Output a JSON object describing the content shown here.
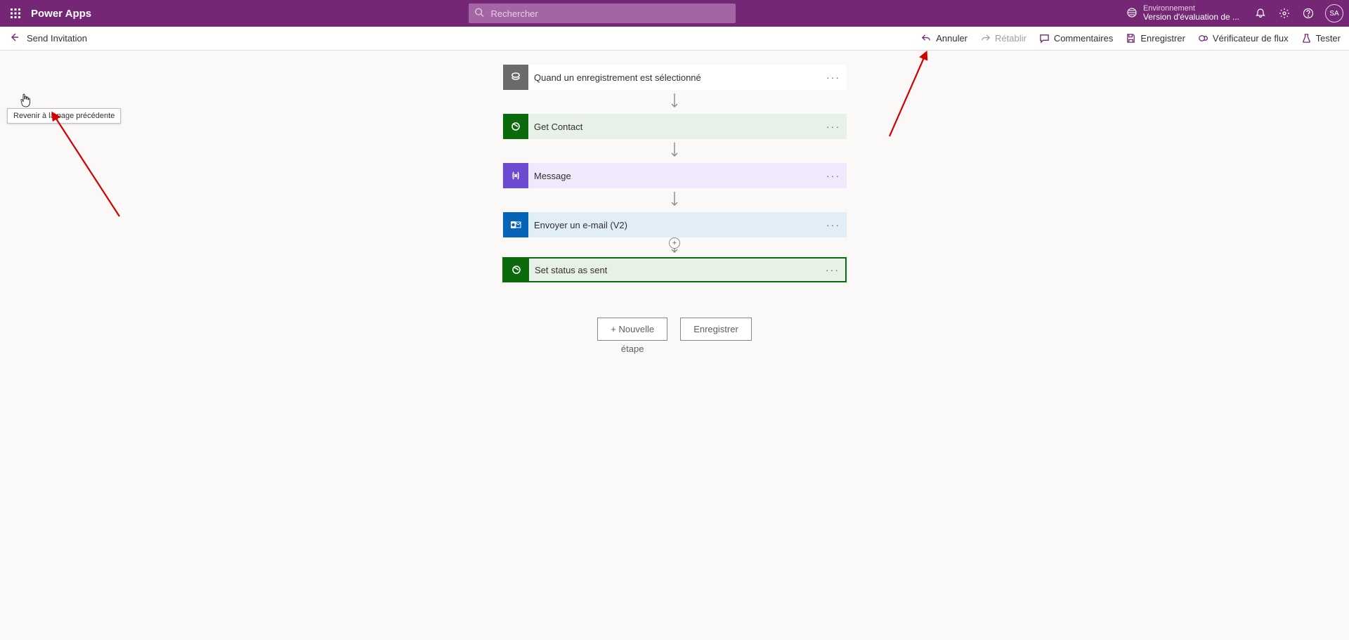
{
  "topbar": {
    "brand": "Power Apps",
    "search_placeholder": "Rechercher",
    "env_label": "Environnement",
    "env_name": "Version d'évaluation de ...",
    "avatar": "SA"
  },
  "toolbar": {
    "flow_name": "Send Invitation",
    "tooltip": "Revenir à la page précédente",
    "actions": {
      "undo": "Annuler",
      "redo": "Rétablir",
      "comments": "Commentaires",
      "save": "Enregistrer",
      "checker": "Vérificateur de flux",
      "test": "Tester"
    }
  },
  "flow": {
    "steps": [
      {
        "title": "Quand un enregistrement est sélectionné",
        "icon": "record",
        "style": "gray",
        "card": "trigger"
      },
      {
        "title": "Get Contact",
        "icon": "dataverse",
        "style": "green",
        "card": "dv"
      },
      {
        "title": "Message",
        "icon": "variable",
        "style": "purple",
        "card": "msg"
      },
      {
        "title": "Envoyer un e-mail (V2)",
        "icon": "outlook",
        "style": "blue",
        "card": "mail"
      },
      {
        "title": "Set status as sent",
        "icon": "dataverse",
        "style": "green",
        "card": "dv selected"
      }
    ],
    "add_label": "+",
    "new_step_top": "+ Nouvelle",
    "new_step_bottom": "étape",
    "save": "Enregistrer"
  }
}
